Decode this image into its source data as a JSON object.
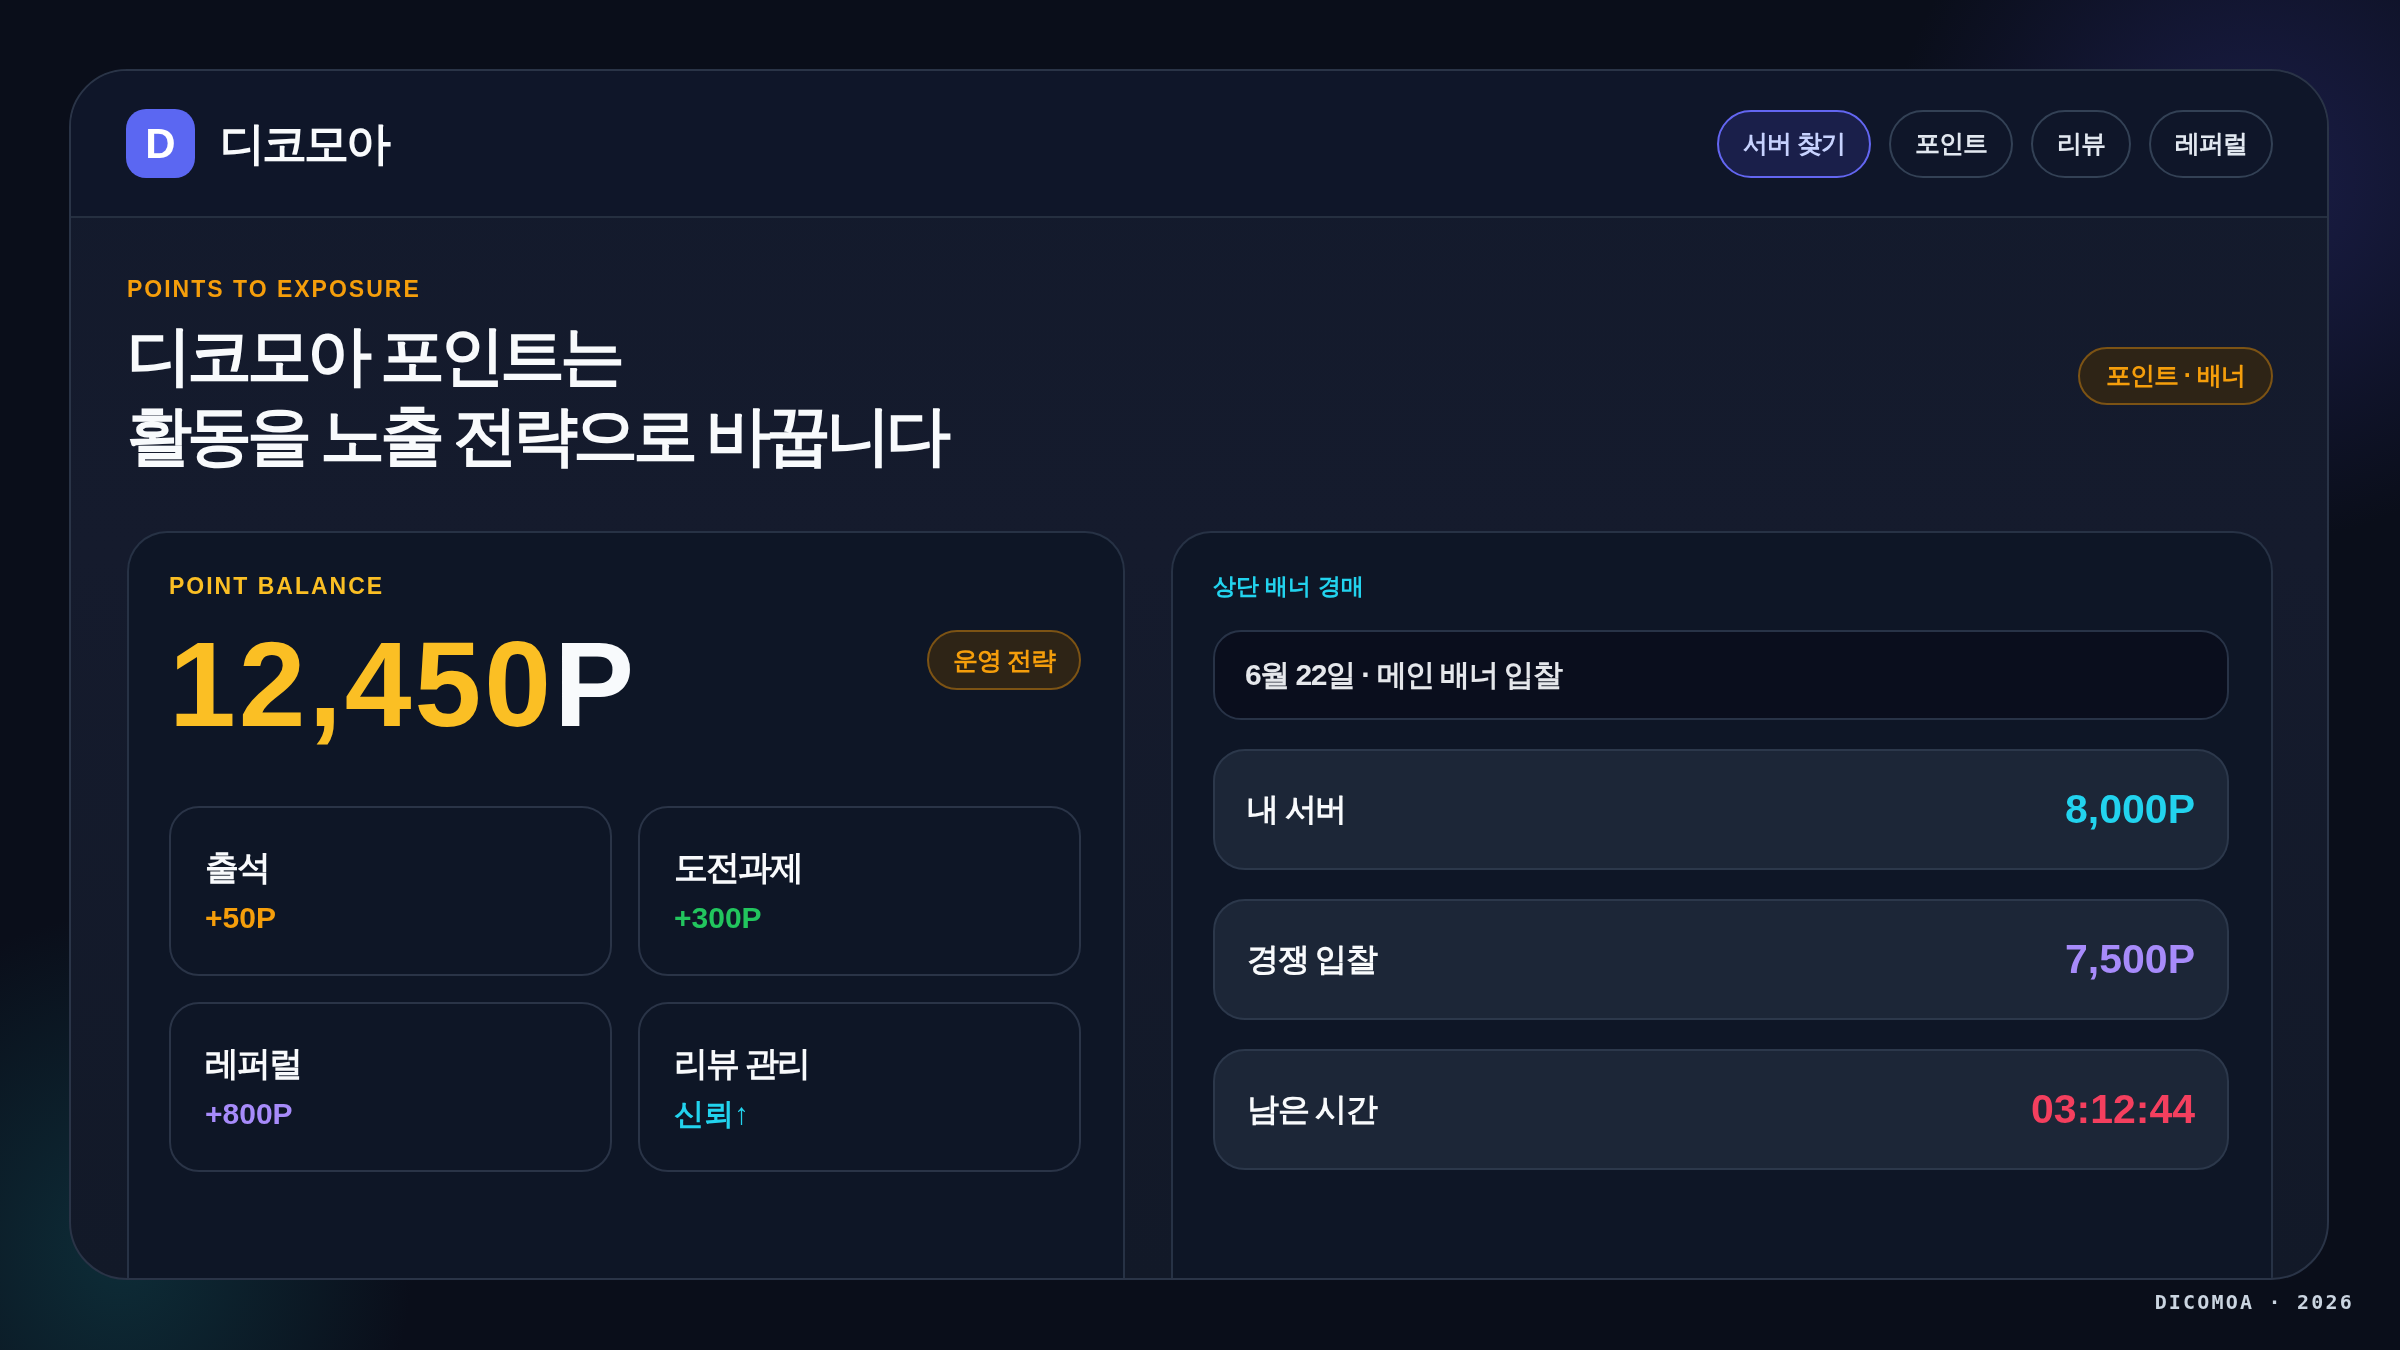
{
  "header": {
    "logo_letter": "D",
    "brand": "디코모아",
    "nav": [
      {
        "label": "서버 찾기",
        "selected": true
      },
      {
        "label": "포인트",
        "selected": false
      },
      {
        "label": "리뷰",
        "selected": false
      },
      {
        "label": "레퍼럴",
        "selected": false
      }
    ]
  },
  "hero": {
    "eyebrow": "POINTS TO EXPOSURE",
    "title_lines": [
      "디코모아 포인트는",
      "활동을 노출 전략으로 바꿉니다"
    ],
    "tag": "포인트 · 배너"
  },
  "balance_card": {
    "label": "POINT BALANCE",
    "amount": "12,450",
    "unit": "P",
    "tag": "운영 전략",
    "rewards": [
      {
        "name": "출석",
        "value": "+50P",
        "color": "#f59e0b"
      },
      {
        "name": "도전과제",
        "value": "+300P",
        "color": "#22c55e"
      },
      {
        "name": "레퍼럴",
        "value": "+800P",
        "color": "#a78bfa"
      },
      {
        "name": "리뷰 관리",
        "value": "신뢰↑",
        "color": "#22d3ee"
      }
    ]
  },
  "auction_card": {
    "label": "상단 배너 경매",
    "headline": "6월 22일 · 메인 배너 입찰",
    "rows": [
      {
        "label": "내 서버",
        "value": "8,000P",
        "color": "#22d3ee"
      },
      {
        "label": "경쟁 입찰",
        "value": "7,500P",
        "color": "#a78bfa"
      },
      {
        "label": "남은 시간",
        "value": "03:12:44",
        "color": "#f43f5e"
      }
    ]
  },
  "footer": "DICOMOA · 2026"
}
